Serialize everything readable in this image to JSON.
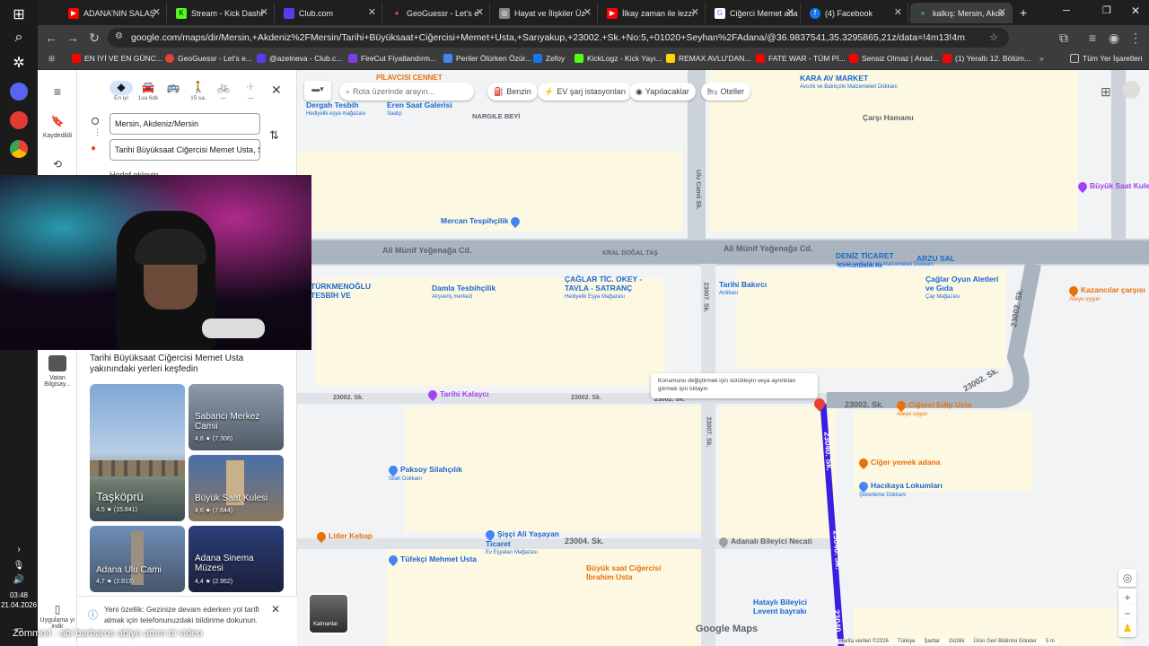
{
  "taskbar": {
    "time": "03:48",
    "date": "21.04.2026"
  },
  "tabs": [
    {
      "label": "ADANA'NIN SALAŞ",
      "color": "#ff0000",
      "glyph": "▶"
    },
    {
      "label": "Stream - Kick Dashb",
      "color": "#53fc18",
      "glyph": "K"
    },
    {
      "label": "Club.com",
      "color": "#5a3cf0",
      "glyph": ""
    },
    {
      "label": "GeoGuessr - Let's e",
      "color": "#ea4335",
      "glyph": "●"
    },
    {
      "label": "Hayat ve İlişkiler Üz",
      "color": "#888",
      "glyph": "◎"
    },
    {
      "label": "İlkay zaman ile lezze",
      "color": "#ff0000",
      "glyph": "▶"
    },
    {
      "label": "Ciğerci Memet ada",
      "color": "#4285f4",
      "glyph": "G"
    },
    {
      "label": "(4) Facebook",
      "color": "#1877f2",
      "glyph": "f"
    },
    {
      "label": "kalkış: Mersin, Akde",
      "color": "#34a853",
      "glyph": "●"
    }
  ],
  "nav": {
    "url": "google.com/maps/dir/Mersin,+Akdeniz%2FMersin/Tarihi+Büyüksaat+Ciğercisi+Memet+Usta,+Sarıyakup,+23002.+Sk.+No:5,+01020+Seyhan%2FAdana/@36.9837541,35.3295865,21z/data=!4m13!4m12!1m5!1m1!1s0x1527f4a4c0..."
  },
  "bookmarks": [
    {
      "label": "EN İYİ VE EN GÜNC...",
      "color": "#ff0000"
    },
    {
      "label": "GeoGuessr - Let's e...",
      "color": "#ea4335"
    },
    {
      "label": "@azelneva - Club.c...",
      "color": "#5a3cf0"
    },
    {
      "label": "FireCut Fiyatlandırm...",
      "color": "#7b3fe4"
    },
    {
      "label": "Periler Ölürken Özür...",
      "color": "#4285f4"
    },
    {
      "label": "Zefoy",
      "color": "#1a73e8"
    },
    {
      "label": "KickLogz - Kick Yayı...",
      "color": "#53fc18"
    },
    {
      "label": "REMAX AVLU'DAN...",
      "color": "#ffd400"
    },
    {
      "label": "FATE WAR - TÜM Pİ...",
      "color": "#ff0000"
    },
    {
      "label": "Sensiz Olmaz | Anad...",
      "color": "#ff0000"
    },
    {
      "label": "(1) Yeraltı 12. Bölüm...",
      "color": "#ff0000"
    },
    {
      "label": "Tüm Yer İşaretleri",
      "color": "#888"
    }
  ],
  "rail": {
    "saved": "Kaydedildi",
    "vatan": "Vatan Bilgisay...",
    "app": "Uygulama yı indir"
  },
  "panel": {
    "modes": [
      {
        "label": "En iyi",
        "icon": "route-icon"
      },
      {
        "label": "1sa 6dk",
        "icon": "car-icon"
      },
      {
        "label": "",
        "icon": "bus-icon"
      },
      {
        "label": "15 sa.",
        "icon": "walk-icon"
      },
      {
        "label": "—",
        "icon": "bike-icon"
      },
      {
        "label": "—",
        "icon": "plane-icon"
      }
    ],
    "origin": "Mersin, Akdeniz/Mersin",
    "destination": "Tarihi Büyüksaat Ciğercisi Memet Usta, S",
    "add_dest": "Hedef ekleyin",
    "nearby_title": "Tarihi Büyüksaat Ciğercisi Memet Usta yakınındaki yerleri keşfedin",
    "cards": [
      {
        "name": "Taşköprü",
        "rating": "4,5 ★ (15.841)"
      },
      {
        "name": "Sabancı Merkez Camii",
        "rating": "4,8 ★ (7.306)"
      },
      {
        "name": "Büyük Saat Kulesi",
        "rating": "4,6 ★ (7.644)"
      },
      {
        "name": "Adana Ulu Cami",
        "rating": "4,7 ★ (2.813)"
      },
      {
        "name": "Adana Sinema Müzesi",
        "rating": "4,4 ★ (2.952)"
      }
    ],
    "notice": "Yeni özellik: Gezinize devam ederken yol tarifi almak için telefonunuzdaki bildirime dokunun."
  },
  "map": {
    "search_placeholder": "Rota üzerinde arayın...",
    "chips": [
      "Benzin",
      "EV şarj istasyonları",
      "Yapılacaklar",
      "Oteller"
    ],
    "tooltip": "Konumunu değiştirmek için sürükleyin veya ayrıntıları görmek için tıklayın",
    "layers": "Katmanlar",
    "logo": "Google Maps",
    "footer": [
      "Harita verileri ©2026",
      "Türkiye",
      "Şartlar",
      "Gizlilik",
      "Ürün Geri Bildirimi Gönder",
      "5 m"
    ],
    "streets": [
      "Ali Münif Yeğenağa Cd.",
      "Ali Münif Yeğenağa Cd.",
      "23002. Sk.",
      "23002. Sk.",
      "23002. Sk.",
      "23002. Sk.",
      "23004. Sk.",
      "23040. Sk.",
      "23040. Sk.",
      "Ulu Camii Sk.",
      "23007. Sk.",
      "23002. Sk.",
      "23007. Sk.",
      "23002. Sk.",
      "23040."
    ],
    "pois": [
      {
        "name": "KARA AV MARKET",
        "sub": "Avcılık ve Balıkçılık Malzemeleri Dükkanı",
        "color": "#4285f4"
      },
      {
        "name": "Çarşı Hamamı",
        "sub": "",
        "color": "#9aa0a6"
      },
      {
        "name": "Büyük Saat Kulesi",
        "sub": "",
        "color": "#a142f4"
      },
      {
        "name": "Dergah Tesbih",
        "sub": "Hediyelik eşya mağazası",
        "color": "#4285f4"
      },
      {
        "name": "Eren Saat Galerisi",
        "sub": "Saatçi",
        "color": "#4285f4"
      },
      {
        "name": "NARGILE BEYİ",
        "sub": "",
        "color": "#9aa0a6"
      },
      {
        "name": "Mercan Tespihçilik",
        "sub": "",
        "color": "#4285f4"
      },
      {
        "name": "KRAL DOĞAL TAŞ",
        "sub": "",
        "color": "#9aa0a6"
      },
      {
        "name": "Damla Tesbihçilik",
        "sub": "Alışveriş merkezi",
        "color": "#4285f4"
      },
      {
        "name": "ÇAĞLAR TİC. OKEY - TAVLA - SATRANÇ",
        "sub": "Hediyelik Eşya Mağazası",
        "color": "#4285f4"
      },
      {
        "name": "Tarihi Bakırcı",
        "sub": "Antikacı",
        "color": "#4285f4"
      },
      {
        "name": "DENİZ TİCARET",
        "sub": "Avcılık ve Balıkçılık Malzemeleri Dükkanı",
        "color": "#4285f4"
      },
      {
        "name": "KirmiziBalık Av",
        "sub": "",
        "color": "#4285f4"
      },
      {
        "name": "ARZU SAL",
        "sub": "",
        "color": "#4285f4"
      },
      {
        "name": "Çağlar Oyun Aletleri ve Gıda",
        "sub": "Çay Mağazası",
        "color": "#4285f4"
      },
      {
        "name": "Kazancılar çarşısı",
        "sub": "Aileye uygun",
        "color": "#e8710a"
      },
      {
        "name": "TÜRKMENOĞLU TESBİH VE",
        "sub": "",
        "color": "#4285f4"
      },
      {
        "name": "Tarihi Kalaycı",
        "sub": "",
        "color": "#a142f4"
      },
      {
        "name": "Ciğerci Edip Usta",
        "sub": "Aileye uygun",
        "color": "#e8710a"
      },
      {
        "name": "Ciğer yemek adana",
        "sub": "",
        "color": "#e8710a"
      },
      {
        "name": "Hacıkaya Lokumları",
        "sub": "Şekerleme Dükkanı",
        "color": "#4285f4"
      },
      {
        "name": "Paksoy Silahçılık",
        "sub": "Silah Dükkanı",
        "color": "#4285f4"
      },
      {
        "name": "Lider Kebap",
        "sub": "",
        "color": "#e8710a"
      },
      {
        "name": "Şişçi Ali Yaşayan Ticaret",
        "sub": "Ev Eşyaları Mağazası",
        "color": "#4285f4"
      },
      {
        "name": "Tüfekçi Mehmet Usta",
        "sub": "",
        "color": "#4285f4"
      },
      {
        "name": "Adanalı Bileyici Necati",
        "sub": "",
        "color": "#9aa0a6"
      },
      {
        "name": "Büyük saat Ciğercisi İbrahim Usta",
        "sub": "",
        "color": "#e8710a"
      },
      {
        "name": "Hataylı Bileyici Levent bayrakı",
        "sub": "",
        "color": "#4285f4"
      },
      {
        "name": "PİLAVCISI CENNET",
        "sub": "",
        "color": "#e8710a"
      }
    ]
  },
  "overlay": {
    "subtitle": "Zommo4 : abi barbaros abiye attım bi video"
  },
  "colors": {
    "road": "#cbd2d9",
    "block": "#fdf8e2",
    "route": "#3b1fe0",
    "accent": "#1a73e8"
  }
}
